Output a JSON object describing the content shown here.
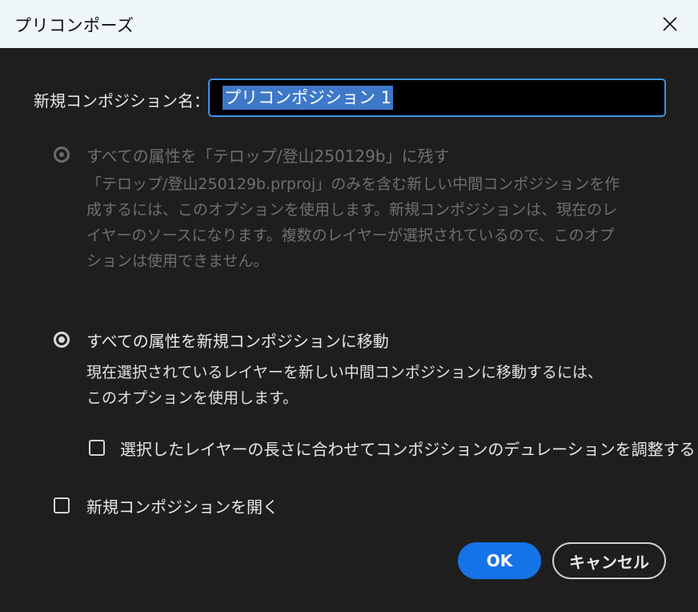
{
  "dialog": {
    "title": "プリコンポーズ",
    "close_icon": "close-icon"
  },
  "name_field": {
    "label": "新規コンポジション名：",
    "value": "プリコンポジション 1"
  },
  "option_keep": {
    "label": "すべての属性を「テロップ/登山250129b」に残す",
    "selected": false,
    "enabled": false,
    "description": [
      "「テロップ/登山250129b.prproj」のみを含む新しい中間コンポジションを作",
      "成するには、このオプションを使用します。新規コンポジションは、現在のレ",
      "イヤーのソースになります。複数のレイヤーが選択されているので、このオプ",
      "ションは使用できません。"
    ]
  },
  "option_move": {
    "label": "すべての属性を新規コンポジションに移動",
    "selected": true,
    "enabled": true,
    "description": [
      "現在選択されているレイヤーを新しい中間コンポジションに移動するには、",
      "このオプションを使用します。"
    ]
  },
  "adjust_duration": {
    "label": "選択したレイヤーの長さに合わせてコンポジションのデュレーションを調整する",
    "checked": false
  },
  "open_new_comp": {
    "label": "新規コンポジションを開く",
    "checked": false
  },
  "buttons": {
    "ok": "OK",
    "cancel": "キャンセル"
  },
  "colors": {
    "accent": "#1473e6",
    "input_border": "#3f92e6",
    "background": "#1e1e1e",
    "titlebar": "#eef6f7"
  }
}
